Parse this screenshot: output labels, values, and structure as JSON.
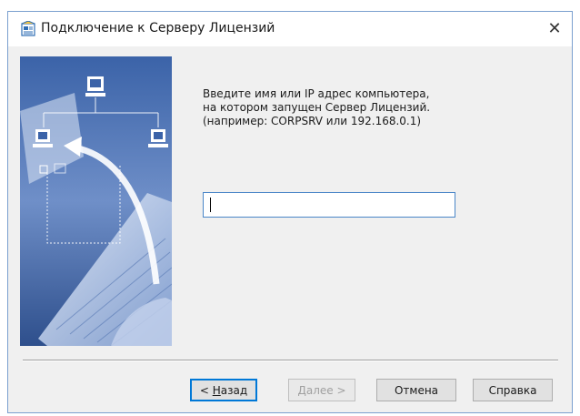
{
  "window": {
    "title": "Подключение к Серверу Лицензий",
    "close_label": "✕"
  },
  "instructions": {
    "line1": "Введите имя или IP адрес компьютера,",
    "line2": "на котором запущен Сервер Лицензий.",
    "line3": "(например: CORPSRV или 192.168.0.1)"
  },
  "ip_input": {
    "value": "",
    "placeholder": ""
  },
  "buttons": {
    "back_prefix": "< ",
    "back_accel": "Н",
    "back_rest": "азад",
    "next_accel": "Д",
    "next_rest": "алее >",
    "cancel": "Отмена",
    "help": "Справка"
  },
  "colors": {
    "focus_border": "#0078d7",
    "window_bg": "#f0f0f0"
  }
}
